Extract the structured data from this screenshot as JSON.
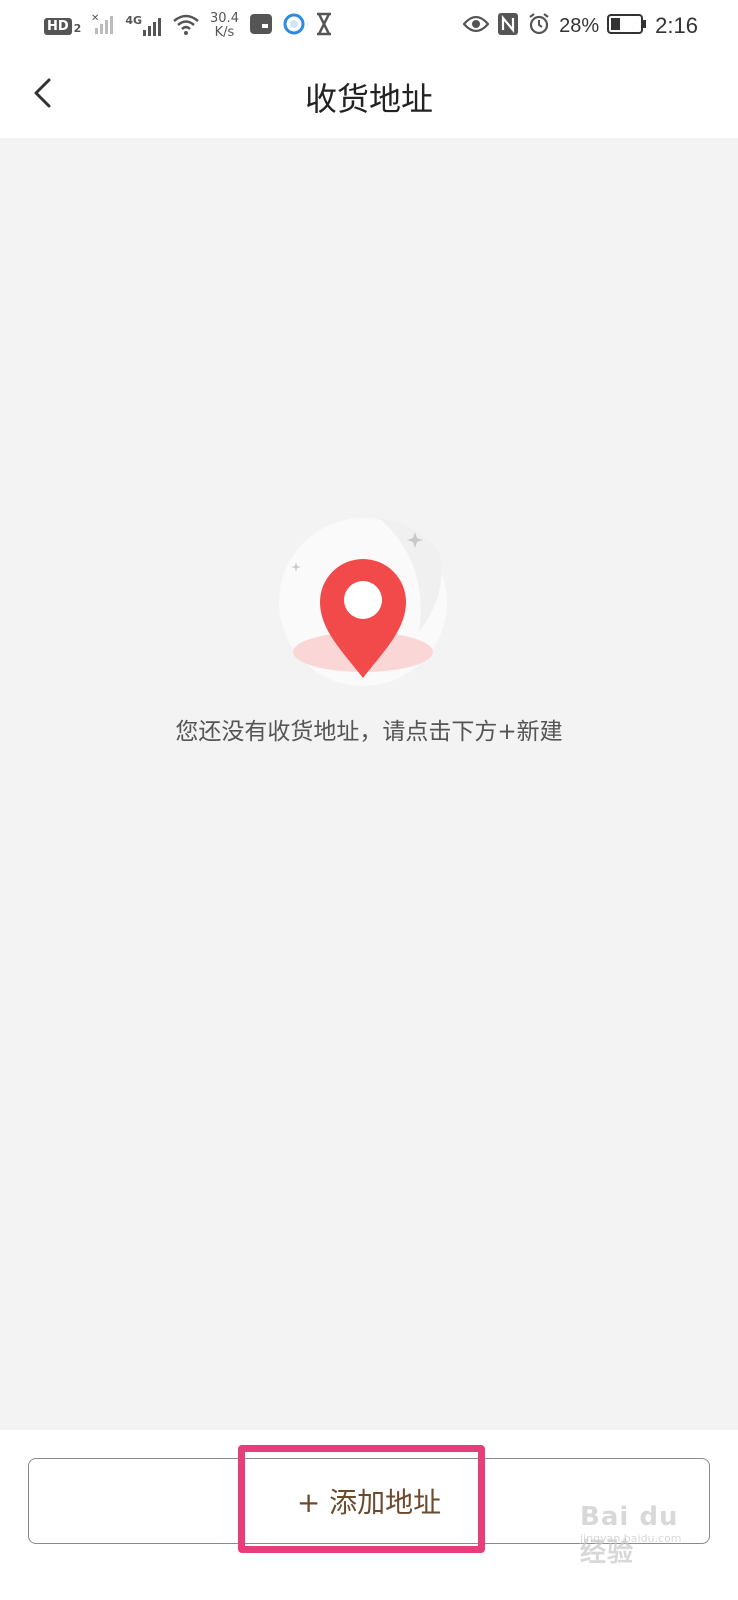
{
  "status_bar": {
    "hd_label": "HD",
    "hd_sim": "2",
    "network_type": "4G",
    "speed_value": "30.4",
    "speed_unit": "K/s",
    "battery_percent": "28%",
    "time": "2:16",
    "icons": [
      "hd-icon",
      "signal-off-icon",
      "signal-4g-icon",
      "wifi-icon",
      "app-notification-icon",
      "browser-icon",
      "hourglass-icon",
      "eye-icon",
      "nfc-icon",
      "alarm-icon",
      "battery-icon"
    ]
  },
  "header": {
    "title": "收货地址",
    "back_icon": "chevron-left-icon"
  },
  "empty_state": {
    "icon": "location-pin-icon",
    "message": "您还没有收货地址，请点击下方+新建"
  },
  "bottom": {
    "add_button_label": "+ 添加地址"
  },
  "watermark": {
    "text": "Bai du 经验",
    "sub": "jingyan.baidu.com"
  },
  "colors": {
    "accent_pin": "#f24a4a",
    "button_text": "#6b4a2e",
    "highlight": "#e63e7b",
    "background": "#f3f3f3"
  }
}
